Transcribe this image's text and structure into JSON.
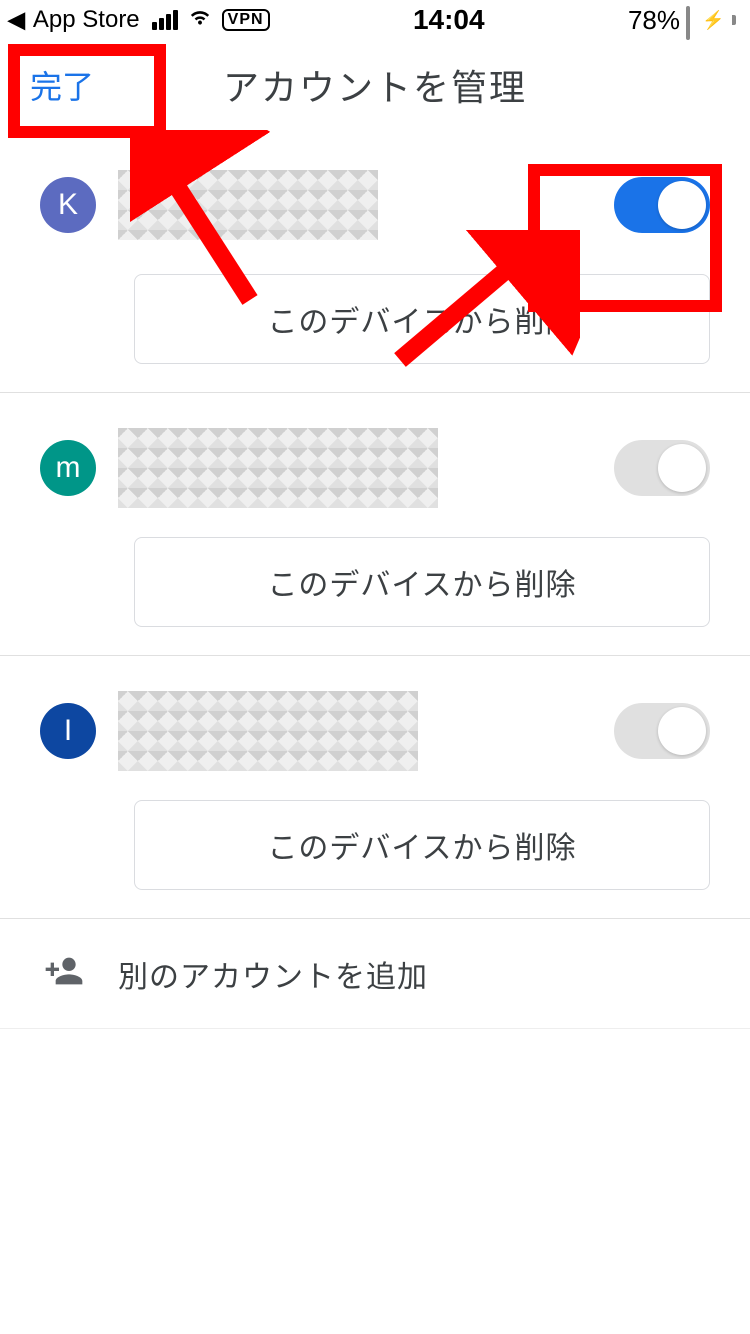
{
  "statusbar": {
    "back_app": "App Store",
    "vpn": "VPN",
    "time": "14:04",
    "battery_pct": "78%"
  },
  "header": {
    "done": "完了",
    "title": "アカウントを管理"
  },
  "accounts": [
    {
      "initial": "K",
      "enabled": true,
      "remove_label": "このデバイスから削除"
    },
    {
      "initial": "m",
      "enabled": false,
      "remove_label": "このデバイスから削除"
    },
    {
      "initial": "I",
      "enabled": false,
      "remove_label": "このデバイスから削除"
    }
  ],
  "add_account": {
    "label": "別のアカウントを追加"
  },
  "annotations": {
    "boxes": [
      "done-button",
      "account-0-toggle"
    ],
    "arrows": 2
  }
}
